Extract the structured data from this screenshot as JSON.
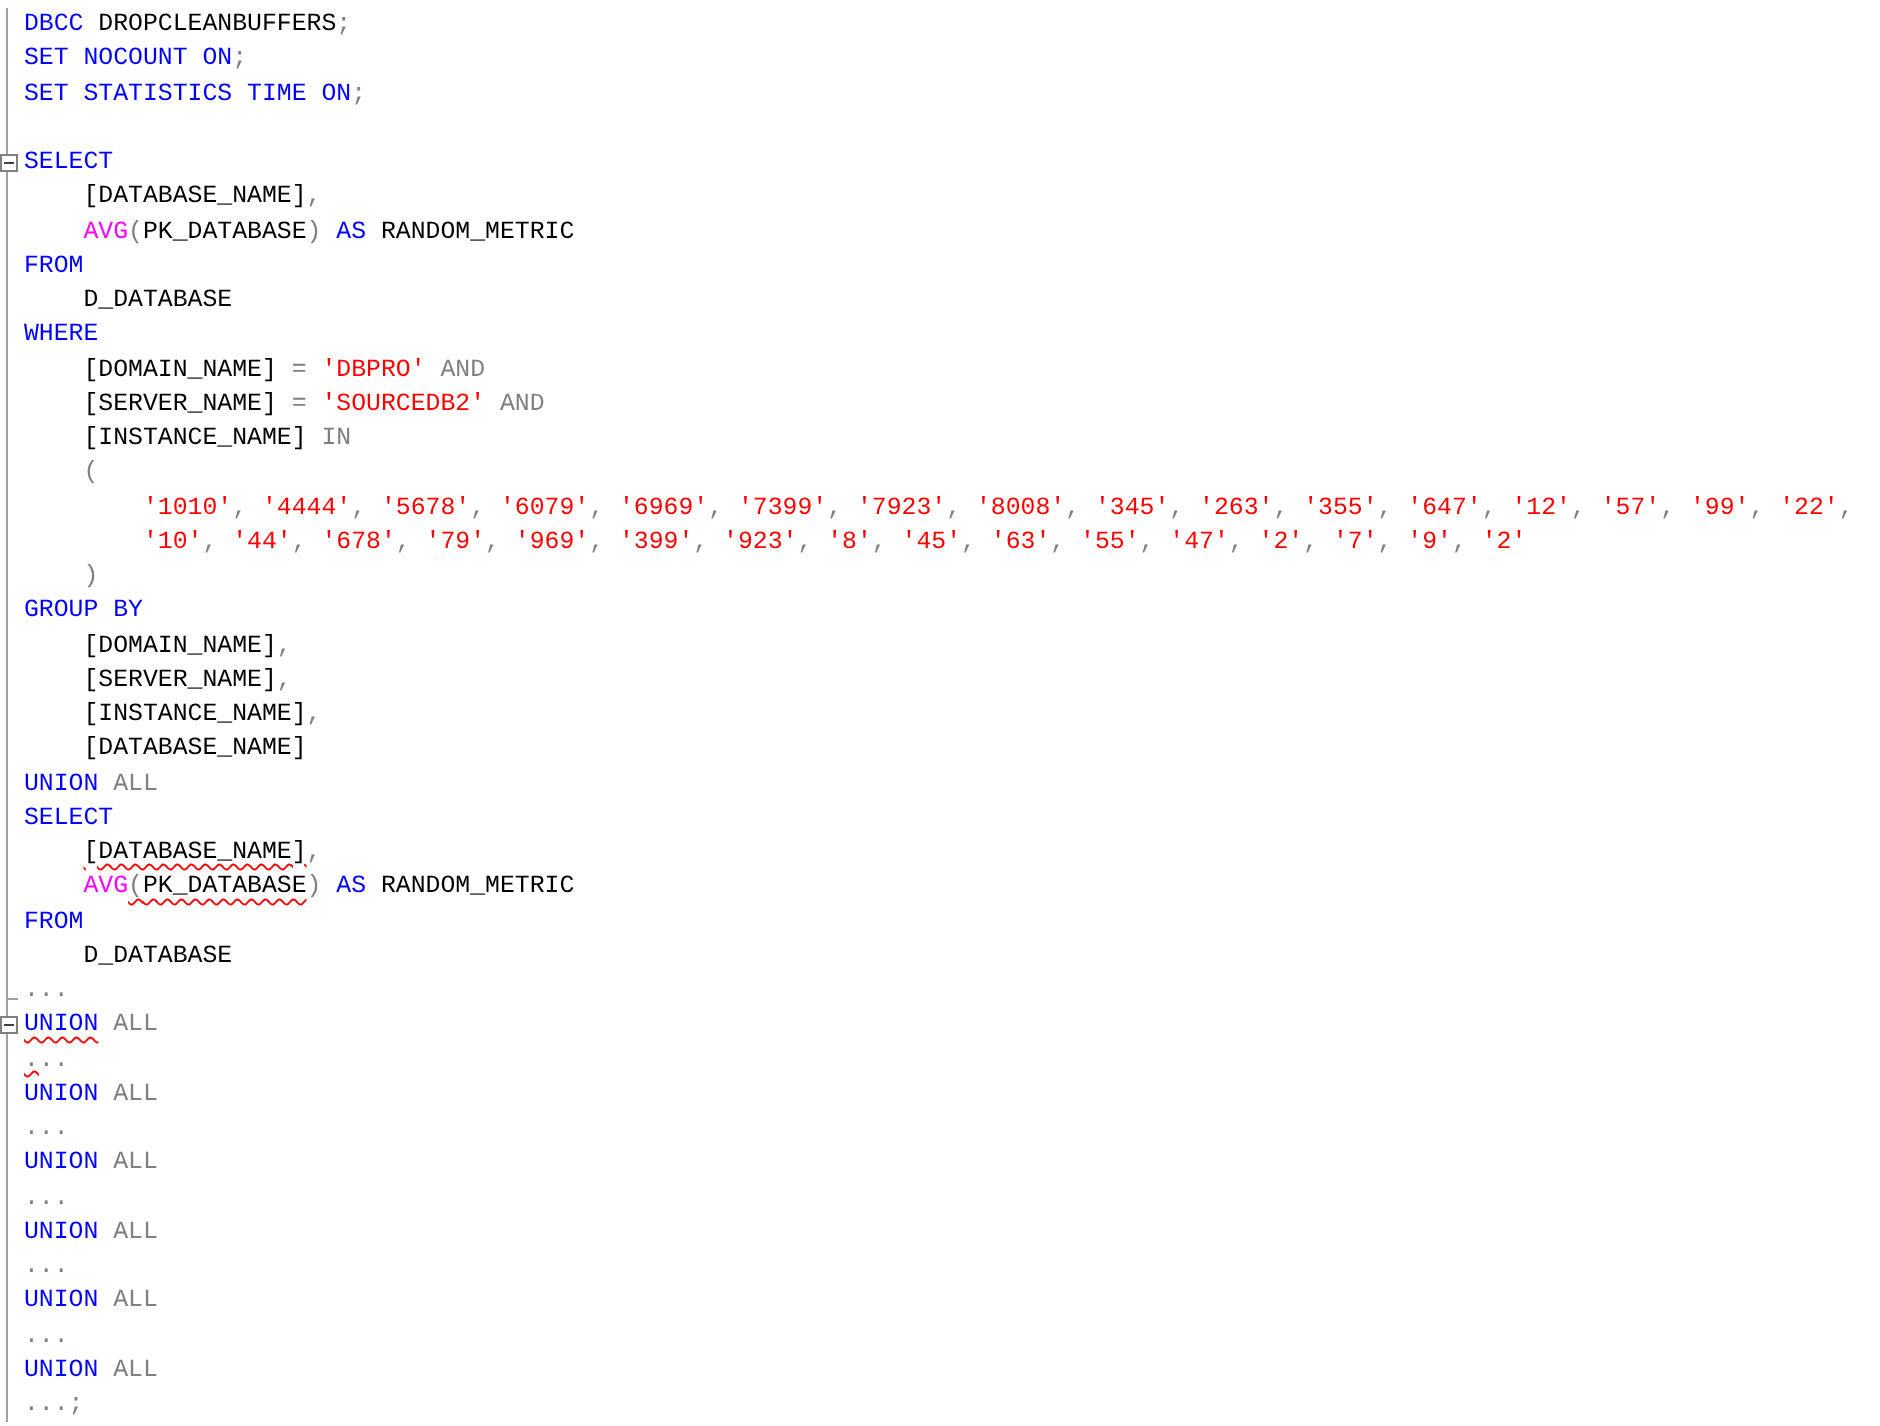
{
  "editor": {
    "lines": [
      {
        "kind": "top",
        "tokens": [
          {
            "kind": "keyword",
            "text": "DBCC"
          },
          {
            "kind": "plain",
            "text": " DROPCLEANBUFFERS"
          },
          {
            "kind": "gray",
            "text": ";"
          }
        ]
      },
      {
        "kind": "top",
        "tokens": [
          {
            "kind": "keyword",
            "text": "SET NOCOUNT ON"
          },
          {
            "kind": "gray",
            "text": ";"
          }
        ]
      },
      {
        "kind": "top",
        "tokens": [
          {
            "kind": "keyword",
            "text": "SET STATISTICS TIME ON"
          },
          {
            "kind": "gray",
            "text": ";"
          }
        ]
      },
      {
        "kind": "blank"
      },
      {
        "kind": "top",
        "collapsible": true,
        "tokens": [
          {
            "kind": "keyword",
            "text": "SELECT"
          }
        ]
      },
      {
        "kind": "indented",
        "tokens": [
          {
            "kind": "plain",
            "text": "[DATABASE_NAME]"
          },
          {
            "kind": "gray",
            "text": ","
          }
        ]
      },
      {
        "kind": "indented",
        "tokens": [
          {
            "kind": "function",
            "text": "AVG"
          },
          {
            "kind": "gray",
            "text": "("
          },
          {
            "kind": "plain",
            "text": "PK_DATABASE"
          },
          {
            "kind": "gray",
            "text": ") "
          },
          {
            "kind": "keyword",
            "text": "AS"
          },
          {
            "kind": "plain",
            "text": " RANDOM_METRIC"
          }
        ]
      },
      {
        "kind": "top",
        "tokens": [
          {
            "kind": "keyword",
            "text": "FROM"
          }
        ]
      },
      {
        "kind": "indented",
        "tokens": [
          {
            "kind": "plain",
            "text": "D_DATABASE"
          }
        ]
      },
      {
        "kind": "top",
        "tokens": [
          {
            "kind": "keyword",
            "text": "WHERE"
          }
        ]
      },
      {
        "kind": "indented",
        "tokens": [
          {
            "kind": "plain",
            "text": "[DOMAIN_NAME] "
          },
          {
            "kind": "gray",
            "text": "= "
          },
          {
            "kind": "string",
            "text": "'DBPRO'"
          },
          {
            "kind": "gray",
            "text": " AND"
          }
        ]
      },
      {
        "kind": "indented",
        "tokens": [
          {
            "kind": "plain",
            "text": "[SERVER_NAME] "
          },
          {
            "kind": "gray",
            "text": "= "
          },
          {
            "kind": "string",
            "text": "'SOURCEDB2'"
          },
          {
            "kind": "gray",
            "text": " AND"
          }
        ]
      },
      {
        "kind": "indented",
        "tokens": [
          {
            "kind": "plain",
            "text": "[INSTANCE_NAME] "
          },
          {
            "kind": "gray",
            "text": "IN"
          }
        ]
      },
      {
        "kind": "indented",
        "tokens": [
          {
            "kind": "gray",
            "text": "("
          }
        ]
      },
      {
        "kind": "nested",
        "tokens": [
          {
            "kind": "string",
            "text": "'1010'"
          },
          {
            "kind": "gray",
            "text": ", "
          },
          {
            "kind": "string",
            "text": "'4444'"
          },
          {
            "kind": "gray",
            "text": ", "
          },
          {
            "kind": "string",
            "text": "'5678'"
          },
          {
            "kind": "gray",
            "text": ", "
          },
          {
            "kind": "string",
            "text": "'6079'"
          },
          {
            "kind": "gray",
            "text": ", "
          },
          {
            "kind": "string",
            "text": "'6969'"
          },
          {
            "kind": "gray",
            "text": ", "
          },
          {
            "kind": "string",
            "text": "'7399'"
          },
          {
            "kind": "gray",
            "text": ", "
          },
          {
            "kind": "string",
            "text": "'7923'"
          },
          {
            "kind": "gray",
            "text": ", "
          },
          {
            "kind": "string",
            "text": "'8008'"
          },
          {
            "kind": "gray",
            "text": ", "
          },
          {
            "kind": "string",
            "text": "'345'"
          },
          {
            "kind": "gray",
            "text": ", "
          },
          {
            "kind": "string",
            "text": "'263'"
          },
          {
            "kind": "gray",
            "text": ", "
          },
          {
            "kind": "string",
            "text": "'355'"
          },
          {
            "kind": "gray",
            "text": ", "
          },
          {
            "kind": "string",
            "text": "'647'"
          },
          {
            "kind": "gray",
            "text": ", "
          },
          {
            "kind": "string",
            "text": "'12'"
          },
          {
            "kind": "gray",
            "text": ", "
          },
          {
            "kind": "string",
            "text": "'57'"
          },
          {
            "kind": "gray",
            "text": ", "
          },
          {
            "kind": "string",
            "text": "'99'"
          },
          {
            "kind": "gray",
            "text": ", "
          },
          {
            "kind": "string",
            "text": "'22'"
          },
          {
            "kind": "gray",
            "text": ","
          }
        ]
      },
      {
        "kind": "nested",
        "tokens": [
          {
            "kind": "string",
            "text": "'10'"
          },
          {
            "kind": "gray",
            "text": ", "
          },
          {
            "kind": "string",
            "text": "'44'"
          },
          {
            "kind": "gray",
            "text": ", "
          },
          {
            "kind": "string",
            "text": "'678'"
          },
          {
            "kind": "gray",
            "text": ", "
          },
          {
            "kind": "string",
            "text": "'79'"
          },
          {
            "kind": "gray",
            "text": ", "
          },
          {
            "kind": "string",
            "text": "'969'"
          },
          {
            "kind": "gray",
            "text": ", "
          },
          {
            "kind": "string",
            "text": "'399'"
          },
          {
            "kind": "gray",
            "text": ", "
          },
          {
            "kind": "string",
            "text": "'923'"
          },
          {
            "kind": "gray",
            "text": ", "
          },
          {
            "kind": "string",
            "text": "'8'"
          },
          {
            "kind": "gray",
            "text": ", "
          },
          {
            "kind": "string",
            "text": "'45'"
          },
          {
            "kind": "gray",
            "text": ", "
          },
          {
            "kind": "string",
            "text": "'63'"
          },
          {
            "kind": "gray",
            "text": ", "
          },
          {
            "kind": "string",
            "text": "'55'"
          },
          {
            "kind": "gray",
            "text": ", "
          },
          {
            "kind": "string",
            "text": "'47'"
          },
          {
            "kind": "gray",
            "text": ", "
          },
          {
            "kind": "string",
            "text": "'2'"
          },
          {
            "kind": "gray",
            "text": ", "
          },
          {
            "kind": "string",
            "text": "'7'"
          },
          {
            "kind": "gray",
            "text": ", "
          },
          {
            "kind": "string",
            "text": "'9'"
          },
          {
            "kind": "gray",
            "text": ", "
          },
          {
            "kind": "string",
            "text": "'2'"
          }
        ]
      },
      {
        "kind": "indented",
        "tokens": [
          {
            "kind": "gray",
            "text": ")"
          }
        ]
      },
      {
        "kind": "top",
        "tokens": [
          {
            "kind": "keyword",
            "text": "GROUP BY"
          }
        ]
      },
      {
        "kind": "indented",
        "tokens": [
          {
            "kind": "plain",
            "text": "[DOMAIN_NAME]"
          },
          {
            "kind": "gray",
            "text": ","
          }
        ]
      },
      {
        "kind": "indented",
        "tokens": [
          {
            "kind": "plain",
            "text": "[SERVER_NAME]"
          },
          {
            "kind": "gray",
            "text": ","
          }
        ]
      },
      {
        "kind": "indented",
        "tokens": [
          {
            "kind": "plain",
            "text": "[INSTANCE_NAME]"
          },
          {
            "kind": "gray",
            "text": ","
          }
        ]
      },
      {
        "kind": "indented",
        "tokens": [
          {
            "kind": "plain",
            "text": "[DATABASE_NAME]"
          }
        ]
      },
      {
        "kind": "top",
        "tokens": [
          {
            "kind": "keyword",
            "text": "UNION"
          },
          {
            "kind": "gray",
            "text": " ALL"
          }
        ]
      },
      {
        "kind": "top",
        "tokens": [
          {
            "kind": "keyword",
            "text": "SELECT"
          }
        ]
      },
      {
        "kind": "indented",
        "tokens": [
          {
            "kind": "plain",
            "text": "[DATABASE_NAME]",
            "squiggle": true
          },
          {
            "kind": "gray",
            "text": ","
          }
        ]
      },
      {
        "kind": "indented",
        "tokens": [
          {
            "kind": "function",
            "text": "AVG"
          },
          {
            "kind": "gray",
            "text": "(",
            "squiggle": true
          },
          {
            "kind": "plain",
            "text": "PK_DATABASE",
            "squiggle": true
          },
          {
            "kind": "gray",
            "text": ") "
          },
          {
            "kind": "keyword",
            "text": "AS"
          },
          {
            "kind": "plain",
            "text": " RANDOM_METRIC"
          }
        ]
      },
      {
        "kind": "top",
        "tokens": [
          {
            "kind": "keyword",
            "text": "FROM"
          }
        ]
      },
      {
        "kind": "indented",
        "tokens": [
          {
            "kind": "plain",
            "text": "D_DATABASE"
          }
        ]
      },
      {
        "kind": "top",
        "fold_end": true,
        "tokens": [
          {
            "kind": "gray",
            "text": "..."
          }
        ]
      },
      {
        "kind": "top",
        "collapsible": true,
        "tokens": [
          {
            "kind": "keyword",
            "text": "UNION",
            "squiggle": true
          },
          {
            "kind": "gray",
            "text": " ALL"
          }
        ]
      },
      {
        "kind": "top",
        "tokens": [
          {
            "kind": "gray",
            "text": ".",
            "squiggle": true
          },
          {
            "kind": "gray",
            "text": ".."
          }
        ]
      },
      {
        "kind": "top",
        "tokens": [
          {
            "kind": "keyword",
            "text": "UNION"
          },
          {
            "kind": "gray",
            "text": " ALL"
          }
        ]
      },
      {
        "kind": "top",
        "tokens": [
          {
            "kind": "gray",
            "text": "..."
          }
        ]
      },
      {
        "kind": "top",
        "tokens": [
          {
            "kind": "keyword",
            "text": "UNION"
          },
          {
            "kind": "gray",
            "text": " ALL"
          }
        ]
      },
      {
        "kind": "top",
        "tokens": [
          {
            "kind": "gray",
            "text": "..."
          }
        ]
      },
      {
        "kind": "top",
        "tokens": [
          {
            "kind": "keyword",
            "text": "UNION"
          },
          {
            "kind": "gray",
            "text": " ALL"
          }
        ]
      },
      {
        "kind": "top",
        "tokens": [
          {
            "kind": "gray",
            "text": "..."
          }
        ]
      },
      {
        "kind": "top",
        "tokens": [
          {
            "kind": "keyword",
            "text": "UNION"
          },
          {
            "kind": "gray",
            "text": " ALL"
          }
        ]
      },
      {
        "kind": "top",
        "tokens": [
          {
            "kind": "gray",
            "text": "..."
          }
        ]
      },
      {
        "kind": "top",
        "tokens": [
          {
            "kind": "keyword",
            "text": "UNION"
          },
          {
            "kind": "gray",
            "text": " ALL"
          }
        ]
      },
      {
        "kind": "top",
        "tokens": [
          {
            "kind": "gray",
            "text": "...;"
          }
        ]
      }
    ]
  }
}
